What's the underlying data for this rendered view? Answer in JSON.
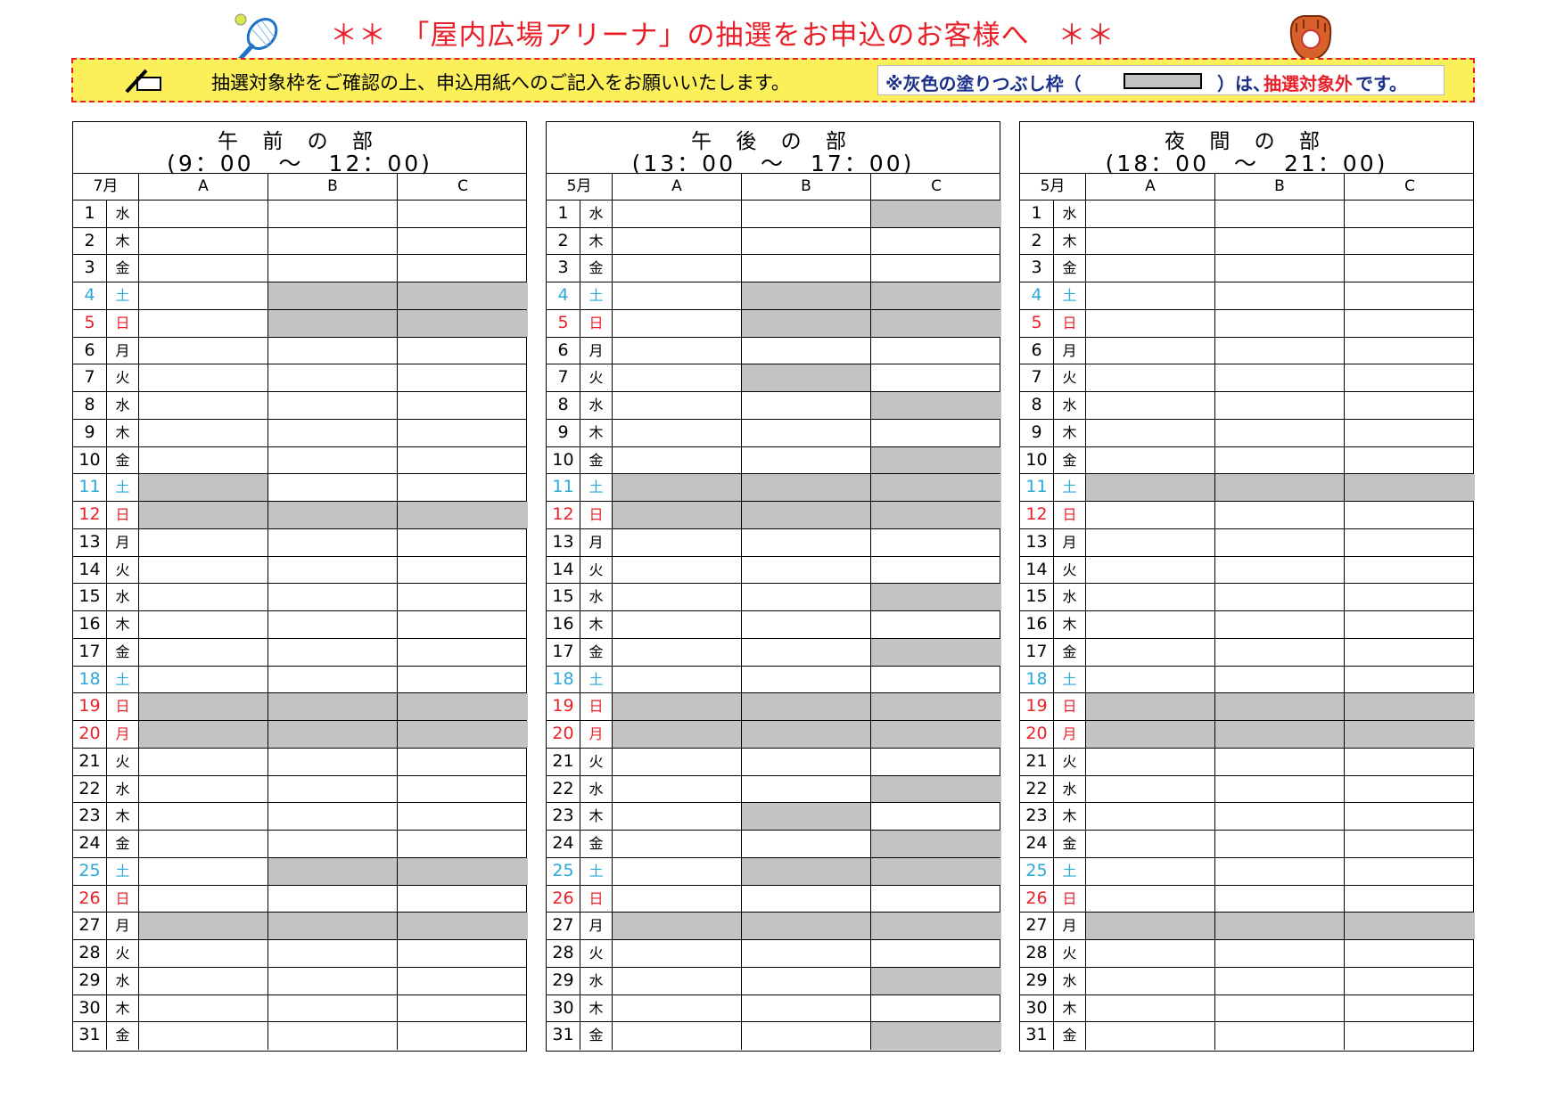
{
  "title": "＊＊　「屋内広場アリーナ」の抽選をお申込のお客様へ　＊＊",
  "notice": {
    "text": "抽選対象枠をご確認の上、申込用紙へのご記入をお願いいたします。",
    "legend_prefix": "※灰色の塗りつぶし枠（",
    "legend_mid": "）は、",
    "legend_highlight": "抽選対象外",
    "legend_suffix": "です。"
  },
  "colors": {
    "title": "#e8202a",
    "notice_bg": "#fbf05a",
    "grey_slot": "#c3c3c3",
    "saturday": "#2aa8d6",
    "sunday": "#e8202a",
    "legend_text": "#1b2f8a"
  },
  "icons": [
    "tennis-racket-icon",
    "baseball-glove-icon",
    "pen-writing-icon"
  ],
  "column_labels": [
    "A",
    "B",
    "C"
  ],
  "weekdays": [
    "水",
    "木",
    "金",
    "土",
    "日",
    "月",
    "火",
    "水",
    "木",
    "金",
    "土",
    "日",
    "月",
    "火",
    "水",
    "木",
    "金",
    "土",
    "日",
    "月",
    "火",
    "水",
    "木",
    "金",
    "土",
    "日",
    "月",
    "火",
    "水",
    "木",
    "金"
  ],
  "day_colors": [
    "n",
    "n",
    "n",
    "sat",
    "sun",
    "n",
    "n",
    "n",
    "n",
    "n",
    "sat",
    "sun",
    "n",
    "n",
    "n",
    "n",
    "n",
    "sat",
    "sun",
    "sun",
    "n",
    "n",
    "n",
    "n",
    "sat",
    "sun",
    "n",
    "n",
    "n",
    "n",
    "n"
  ],
  "tables": [
    {
      "heading": "午 前 の 部",
      "time": "(9：00　～　12：00)",
      "month": "7月",
      "unavailable": {
        "4": [
          "B",
          "C"
        ],
        "5": [
          "B",
          "C"
        ],
        "11": [
          "A"
        ],
        "12": [
          "A",
          "B",
          "C"
        ],
        "19": [
          "A",
          "B",
          "C"
        ],
        "20": [
          "A",
          "B",
          "C"
        ],
        "25": [
          "B",
          "C"
        ],
        "27": [
          "A",
          "B",
          "C"
        ]
      }
    },
    {
      "heading": "午 後 の 部",
      "time": "(13：00　～　17：00)",
      "month": "5月",
      "unavailable": {
        "1": [
          "C"
        ],
        "4": [
          "B",
          "C"
        ],
        "5": [
          "B",
          "C"
        ],
        "7": [
          "B"
        ],
        "8": [
          "C"
        ],
        "10": [
          "C"
        ],
        "11": [
          "A",
          "B",
          "C"
        ],
        "12": [
          "A",
          "B",
          "C"
        ],
        "15": [
          "C"
        ],
        "17": [
          "C"
        ],
        "19": [
          "A",
          "B",
          "C"
        ],
        "20": [
          "A",
          "B",
          "C"
        ],
        "22": [
          "C"
        ],
        "23": [
          "B"
        ],
        "24": [
          "C"
        ],
        "25": [
          "B",
          "C"
        ],
        "27": [
          "A",
          "B",
          "C"
        ],
        "29": [
          "C"
        ],
        "31": [
          "C"
        ]
      }
    },
    {
      "heading": "夜 間 の 部",
      "time": "(18：00　～　21：00)",
      "month": "5月",
      "unavailable": {
        "11": [
          "A",
          "B",
          "C"
        ],
        "19": [
          "A",
          "B",
          "C"
        ],
        "20": [
          "A",
          "B",
          "C"
        ],
        "27": [
          "A",
          "B",
          "C"
        ]
      }
    }
  ]
}
